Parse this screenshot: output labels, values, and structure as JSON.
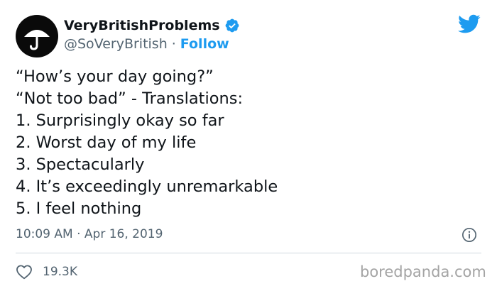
{
  "author": {
    "display_name": "VeryBritishProblems",
    "handle": "@SoVeryBritish",
    "separator": "·",
    "follow_label": "Follow",
    "verified": true,
    "avatar_icon": "umbrella-icon"
  },
  "tweet": {
    "lines": [
      "“How’s your day going?”",
      "“Not too bad” - Translations:",
      "1. Surprisingly okay so far",
      "2. Worst day of my life",
      "3. Spectacularly",
      "4. It’s exceedingly unremarkable",
      "5. I feel nothing"
    ],
    "timestamp": "10:09 AM · Apr 16, 2019",
    "like_count": "19.3K"
  },
  "watermark": "boredpanda.com",
  "colors": {
    "brand_blue": "#1d9bf0",
    "text": "#0f1419",
    "muted": "#536471",
    "divider": "#cfd9de"
  }
}
